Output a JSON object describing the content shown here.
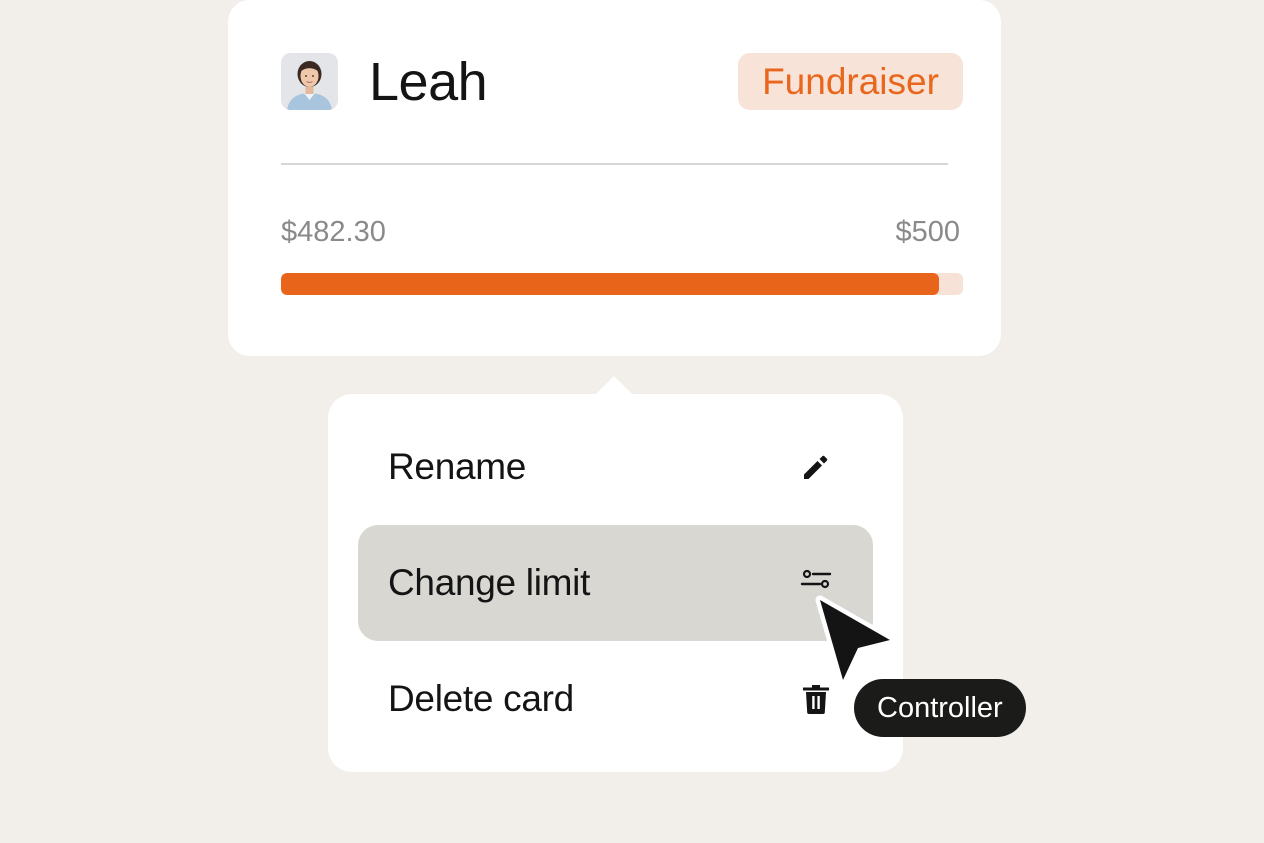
{
  "card": {
    "name": "Leah",
    "badge": "Fundraiser",
    "amount_current": "$482.30",
    "amount_limit": "$500",
    "progress_fraction": 0.9646,
    "avatar_icon": "person-photo-icon"
  },
  "menu": {
    "items": [
      {
        "label": "Rename",
        "icon": "pencil-icon",
        "active": false
      },
      {
        "label": "Change limit",
        "icon": "sliders-icon",
        "active": true
      },
      {
        "label": "Delete card",
        "icon": "trash-icon",
        "active": false
      }
    ]
  },
  "cursor": {
    "icon": "mouse-pointer-icon",
    "tooltip": "Controller"
  },
  "colors": {
    "background": "#f2efea",
    "accent_orange": "#e8641b",
    "badge_bg": "#f8e3d8",
    "progress_track": "#f7e2d8",
    "active_item_bg": "#d9d7d2",
    "tooltip_bg": "#1b1b19"
  }
}
